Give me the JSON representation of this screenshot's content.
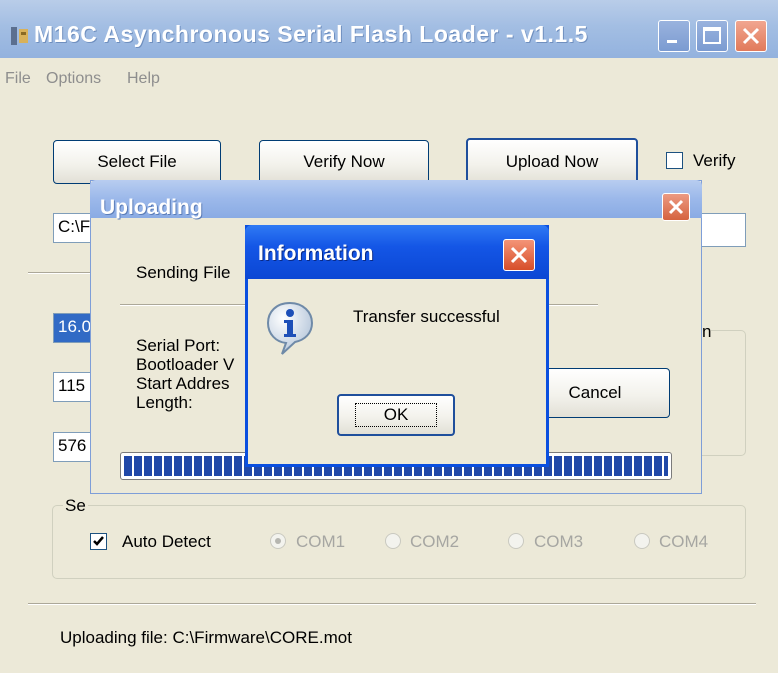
{
  "window": {
    "title": "M16C Asynchronous Serial Flash Loader - v1.1.5"
  },
  "menu": [
    "File",
    "Options",
    "Help"
  ],
  "toolbar": {
    "select_file": "Select File",
    "verify_now": "Verify Now",
    "upload_now": "Upload Now",
    "verify_checkbox_label": "Verify",
    "verify_checked": false
  },
  "file_path_field": "C:\\F",
  "left_fields": [
    "16.0",
    "115",
    "576"
  ],
  "right_group_fragment": "n",
  "serial_group": {
    "title_fragment": "Se",
    "auto_detect_label": "Auto Detect",
    "auto_detect_checked": true,
    "ports": [
      "COM1",
      "COM2",
      "COM3",
      "COM4"
    ],
    "selected_port": "COM1"
  },
  "status_text": "Uploading file: C:\\Firmware\\CORE.mot",
  "uploading_dialog": {
    "title": "Uploading",
    "sending_label": "Sending File",
    "info_labels": [
      "Serial Port:",
      "Bootloader V",
      "Start Addres",
      "Length:"
    ],
    "cancel_label": "Cancel",
    "progress": 1.0
  },
  "info_dialog": {
    "title": "Information",
    "message": "Transfer successful",
    "ok_label": "OK",
    "icon": "information-icon"
  },
  "colors": {
    "xp_blue_title": "#0b47d4",
    "inactive_title": "#a3bee3",
    "progress_block": "#2048a8",
    "window_bg": "#ece9d8"
  }
}
